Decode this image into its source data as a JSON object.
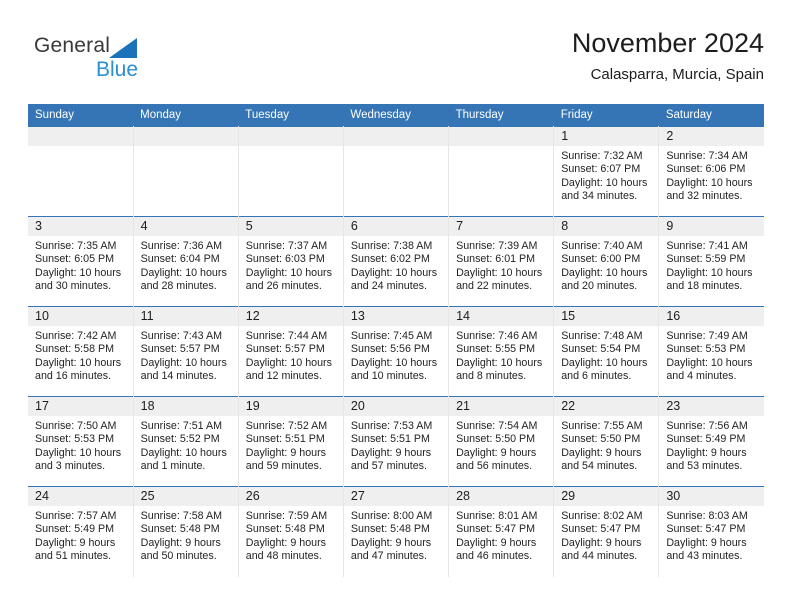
{
  "brand": {
    "name_part1": "General",
    "name_part2": "Blue",
    "triangle_color": "#1c72b8",
    "blue_color": "#2b8fd4"
  },
  "header": {
    "title": "November 2024",
    "subtitle": "Calasparra, Murcia, Spain"
  },
  "theme": {
    "header_blue": "#3575b5",
    "daynum_band": "#efefef",
    "cell_border": "#e6e6e6"
  },
  "calendar": {
    "weekday_headers": [
      "Sunday",
      "Monday",
      "Tuesday",
      "Wednesday",
      "Thursday",
      "Friday",
      "Saturday"
    ],
    "weeks": [
      [
        {
          "day": "",
          "lines": []
        },
        {
          "day": "",
          "lines": []
        },
        {
          "day": "",
          "lines": []
        },
        {
          "day": "",
          "lines": []
        },
        {
          "day": "",
          "lines": []
        },
        {
          "day": "1",
          "lines": [
            "Sunrise: 7:32 AM",
            "Sunset: 6:07 PM",
            "Daylight: 10 hours",
            "and 34 minutes."
          ]
        },
        {
          "day": "2",
          "lines": [
            "Sunrise: 7:34 AM",
            "Sunset: 6:06 PM",
            "Daylight: 10 hours",
            "and 32 minutes."
          ]
        }
      ],
      [
        {
          "day": "3",
          "lines": [
            "Sunrise: 7:35 AM",
            "Sunset: 6:05 PM",
            "Daylight: 10 hours",
            "and 30 minutes."
          ]
        },
        {
          "day": "4",
          "lines": [
            "Sunrise: 7:36 AM",
            "Sunset: 6:04 PM",
            "Daylight: 10 hours",
            "and 28 minutes."
          ]
        },
        {
          "day": "5",
          "lines": [
            "Sunrise: 7:37 AM",
            "Sunset: 6:03 PM",
            "Daylight: 10 hours",
            "and 26 minutes."
          ]
        },
        {
          "day": "6",
          "lines": [
            "Sunrise: 7:38 AM",
            "Sunset: 6:02 PM",
            "Daylight: 10 hours",
            "and 24 minutes."
          ]
        },
        {
          "day": "7",
          "lines": [
            "Sunrise: 7:39 AM",
            "Sunset: 6:01 PM",
            "Daylight: 10 hours",
            "and 22 minutes."
          ]
        },
        {
          "day": "8",
          "lines": [
            "Sunrise: 7:40 AM",
            "Sunset: 6:00 PM",
            "Daylight: 10 hours",
            "and 20 minutes."
          ]
        },
        {
          "day": "9",
          "lines": [
            "Sunrise: 7:41 AM",
            "Sunset: 5:59 PM",
            "Daylight: 10 hours",
            "and 18 minutes."
          ]
        }
      ],
      [
        {
          "day": "10",
          "lines": [
            "Sunrise: 7:42 AM",
            "Sunset: 5:58 PM",
            "Daylight: 10 hours",
            "and 16 minutes."
          ]
        },
        {
          "day": "11",
          "lines": [
            "Sunrise: 7:43 AM",
            "Sunset: 5:57 PM",
            "Daylight: 10 hours",
            "and 14 minutes."
          ]
        },
        {
          "day": "12",
          "lines": [
            "Sunrise: 7:44 AM",
            "Sunset: 5:57 PM",
            "Daylight: 10 hours",
            "and 12 minutes."
          ]
        },
        {
          "day": "13",
          "lines": [
            "Sunrise: 7:45 AM",
            "Sunset: 5:56 PM",
            "Daylight: 10 hours",
            "and 10 minutes."
          ]
        },
        {
          "day": "14",
          "lines": [
            "Sunrise: 7:46 AM",
            "Sunset: 5:55 PM",
            "Daylight: 10 hours",
            "and 8 minutes."
          ]
        },
        {
          "day": "15",
          "lines": [
            "Sunrise: 7:48 AM",
            "Sunset: 5:54 PM",
            "Daylight: 10 hours",
            "and 6 minutes."
          ]
        },
        {
          "day": "16",
          "lines": [
            "Sunrise: 7:49 AM",
            "Sunset: 5:53 PM",
            "Daylight: 10 hours",
            "and 4 minutes."
          ]
        }
      ],
      [
        {
          "day": "17",
          "lines": [
            "Sunrise: 7:50 AM",
            "Sunset: 5:53 PM",
            "Daylight: 10 hours",
            "and 3 minutes."
          ]
        },
        {
          "day": "18",
          "lines": [
            "Sunrise: 7:51 AM",
            "Sunset: 5:52 PM",
            "Daylight: 10 hours",
            "and 1 minute."
          ]
        },
        {
          "day": "19",
          "lines": [
            "Sunrise: 7:52 AM",
            "Sunset: 5:51 PM",
            "Daylight: 9 hours",
            "and 59 minutes."
          ]
        },
        {
          "day": "20",
          "lines": [
            "Sunrise: 7:53 AM",
            "Sunset: 5:51 PM",
            "Daylight: 9 hours",
            "and 57 minutes."
          ]
        },
        {
          "day": "21",
          "lines": [
            "Sunrise: 7:54 AM",
            "Sunset: 5:50 PM",
            "Daylight: 9 hours",
            "and 56 minutes."
          ]
        },
        {
          "day": "22",
          "lines": [
            "Sunrise: 7:55 AM",
            "Sunset: 5:50 PM",
            "Daylight: 9 hours",
            "and 54 minutes."
          ]
        },
        {
          "day": "23",
          "lines": [
            "Sunrise: 7:56 AM",
            "Sunset: 5:49 PM",
            "Daylight: 9 hours",
            "and 53 minutes."
          ]
        }
      ],
      [
        {
          "day": "24",
          "lines": [
            "Sunrise: 7:57 AM",
            "Sunset: 5:49 PM",
            "Daylight: 9 hours",
            "and 51 minutes."
          ]
        },
        {
          "day": "25",
          "lines": [
            "Sunrise: 7:58 AM",
            "Sunset: 5:48 PM",
            "Daylight: 9 hours",
            "and 50 minutes."
          ]
        },
        {
          "day": "26",
          "lines": [
            "Sunrise: 7:59 AM",
            "Sunset: 5:48 PM",
            "Daylight: 9 hours",
            "and 48 minutes."
          ]
        },
        {
          "day": "27",
          "lines": [
            "Sunrise: 8:00 AM",
            "Sunset: 5:48 PM",
            "Daylight: 9 hours",
            "and 47 minutes."
          ]
        },
        {
          "day": "28",
          "lines": [
            "Sunrise: 8:01 AM",
            "Sunset: 5:47 PM",
            "Daylight: 9 hours",
            "and 46 minutes."
          ]
        },
        {
          "day": "29",
          "lines": [
            "Sunrise: 8:02 AM",
            "Sunset: 5:47 PM",
            "Daylight: 9 hours",
            "and 44 minutes."
          ]
        },
        {
          "day": "30",
          "lines": [
            "Sunrise: 8:03 AM",
            "Sunset: 5:47 PM",
            "Daylight: 9 hours",
            "and 43 minutes."
          ]
        }
      ]
    ]
  }
}
